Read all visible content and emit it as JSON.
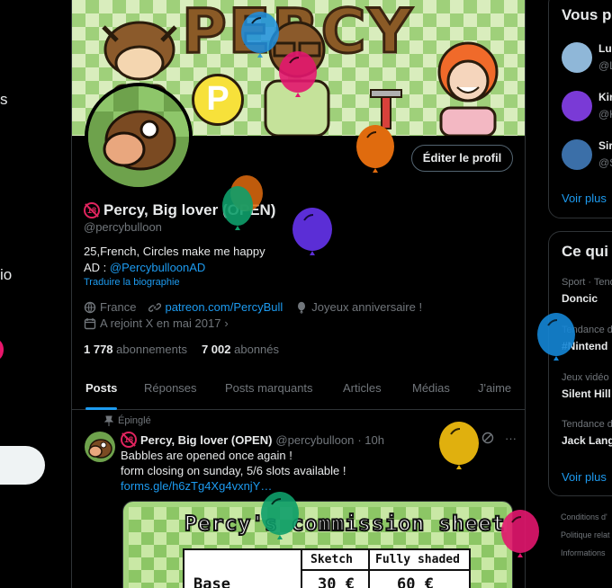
{
  "left_nav": {
    "frag_s": "s",
    "frag_io": "io"
  },
  "banner": {
    "title": "PERCY",
    "p_letter": "P"
  },
  "profile": {
    "edit_button": "Éditer le profil",
    "age_badge": "18",
    "name": "Percy, Big lover (OPEN)",
    "handle": "@percybulloon",
    "bio_line1": "25,French, Circles make me happy",
    "bio_ad_prefix": "AD : ",
    "bio_ad_link": "@PercybulloonAD",
    "translate": "Traduire la biographie",
    "location": "France",
    "website": "patreon.com/PercyBull",
    "birthday": "Joyeux anniversaire !",
    "joined": "A rejoint X en mai 2017",
    "following_count": "1 778",
    "following_label": "abonnements",
    "followers_count": "7 002",
    "followers_label": "abonnés"
  },
  "tabs": [
    "Posts",
    "Réponses",
    "Posts marquants",
    "Articles",
    "Médias",
    "J'aime"
  ],
  "post": {
    "pinned_label": "Épinglé",
    "author_name": "Percy, Big lover (OPEN)",
    "author_handle": "@percybulloon",
    "time": "· 10h",
    "line1": "Babbles are opened once again !",
    "line2": "form closing on sunday, 5/6 slots available !",
    "link": "forms.gle/h6zTg4Xg4vxnjY…",
    "more": "···",
    "sheet": {
      "title": "Percy's commission sheet",
      "col_sketch": "Sketch",
      "col_full": "Fully shaded",
      "row_base": "Base",
      "price_sketch": "30 €",
      "price_full": "60 €"
    }
  },
  "right": {
    "who_title": "Vous p",
    "who": [
      {
        "name": "Lu",
        "handle": "@L",
        "color": "#8fb7d8"
      },
      {
        "name": "Kin",
        "handle": "@K",
        "color": "#7a3ad6"
      },
      {
        "name": "Sir",
        "handle": "@S",
        "color": "#3b6fa8"
      }
    ],
    "see_more_1": "Voir plus",
    "trends_title": "Ce qui",
    "trends": [
      {
        "meta": "Sport · Tend",
        "name": "Doncic"
      },
      {
        "meta": "Tendance d",
        "name": "#Nintend"
      },
      {
        "meta": "Jeux vidéo ·",
        "name": "Silent Hill"
      },
      {
        "meta": "Tendance d",
        "name": "Jack Lang"
      }
    ],
    "see_more_2": "Voir plus",
    "footer": [
      "Conditions d'",
      "Politique relat",
      "Informations"
    ]
  },
  "colors": {
    "accent": "#1d9bf0",
    "balloon_orange": "#e06b0e",
    "balloon_purple": "#5b2ed6",
    "balloon_green": "#0e9e6a",
    "balloon_blue": "#1486d6",
    "balloon_yellow": "#e0b00e",
    "balloon_pink": "#e2166e"
  }
}
